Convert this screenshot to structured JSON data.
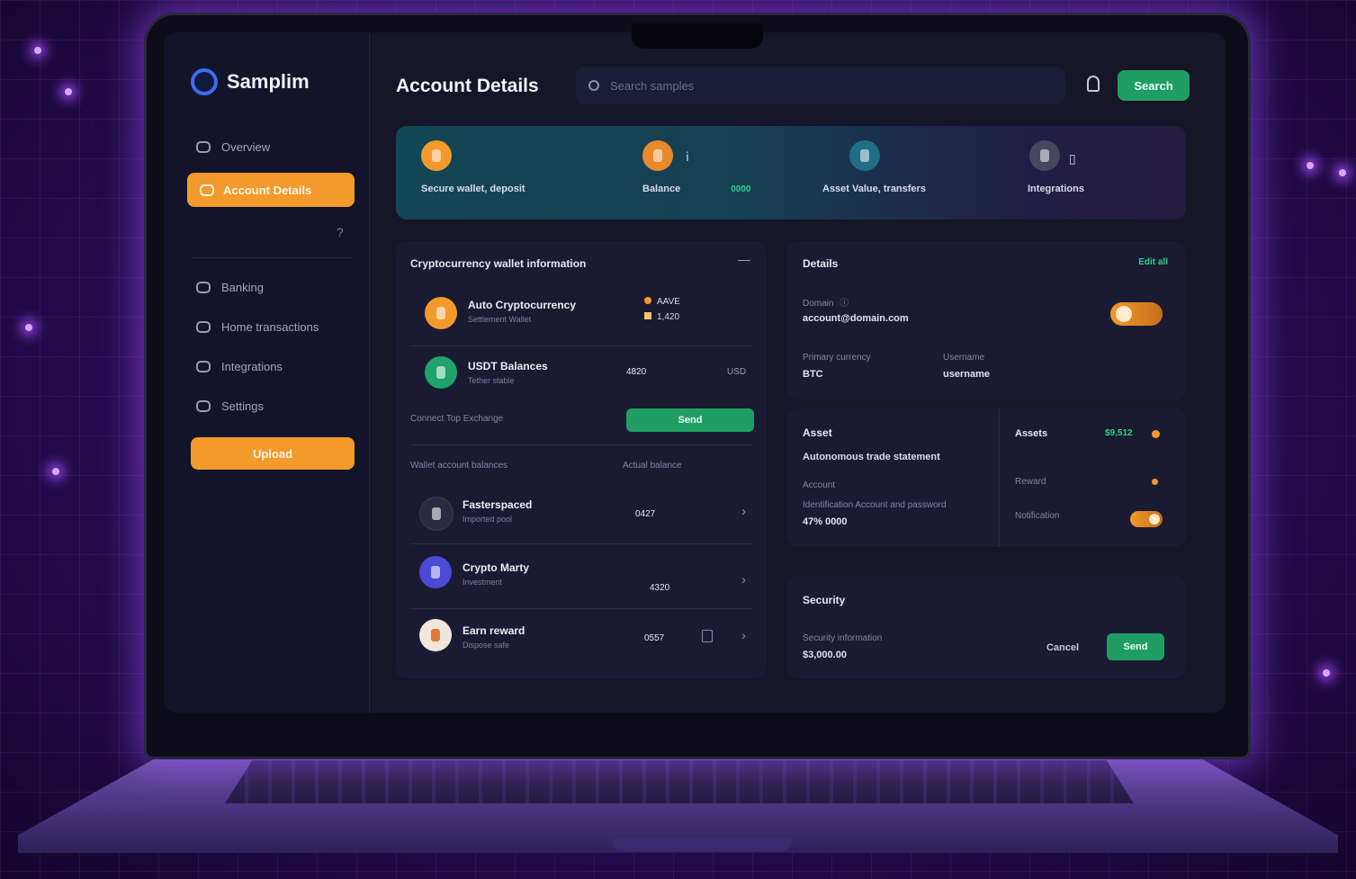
{
  "window": {
    "title": "Account Details"
  },
  "brand": {
    "name": "Samplim"
  },
  "topbar": {
    "title": "Account Details",
    "search_placeholder": "Search samples",
    "cta_label": "Search"
  },
  "sidebar": {
    "items": [
      {
        "label": "Overview",
        "icon": "chat-icon",
        "active": false
      },
      {
        "label": "Account Details",
        "icon": "wallet-icon",
        "active": true
      },
      {
        "label": "Banking",
        "icon": "bank-icon",
        "active": false
      },
      {
        "label": "Home transactions",
        "icon": "home-icon",
        "active": false
      },
      {
        "label": "Integrations",
        "icon": "plug-icon",
        "active": false
      },
      {
        "label": "Settings",
        "icon": "gear-icon",
        "active": false
      }
    ],
    "mark": "?",
    "button_label": "Upload"
  },
  "stats": [
    {
      "label": "Secure wallet, deposit",
      "color": "#f39a2c",
      "sub": ""
    },
    {
      "label": "Balance",
      "color": "#e88a2a",
      "sub": "0000"
    },
    {
      "label": "Asset Value, transfers",
      "color": "#1e6f86",
      "sub": ""
    },
    {
      "label": "Integrations",
      "color": "#46465e",
      "sub": ""
    }
  ],
  "account_card": {
    "title": "Cryptocurrency wallet information",
    "collapse_icon": "—",
    "holdings": [
      {
        "name": "Auto Cryptocurrency",
        "sub": "Settlement Wallet",
        "color": "#f39a2c",
        "tag1": "AAVE",
        "tag2": "1,420"
      },
      {
        "name": "USDT Balances",
        "sub": "Tether stable",
        "color": "#1fa36b",
        "value": "4820",
        "unit": "USD"
      }
    ],
    "connect_text": "Connect Top Exchange",
    "connect_button": "Send",
    "list_header_left": "Wallet account balances",
    "list_header_right": "Actual balance",
    "transactions": [
      {
        "name": "Fasterspaced",
        "sub": "Imported pool",
        "value": "0427",
        "color": "#2a2a40"
      },
      {
        "name": "Crypto Marty",
        "sub": "Investment",
        "value": "4320",
        "color": "#4a49d8"
      },
      {
        "name": "Earn reward",
        "sub": "Dispose safe",
        "value": "0557",
        "color": "#f0e6dc"
      }
    ]
  },
  "details_card": {
    "title": "Details",
    "link": "Edit all",
    "field1_label": "Domain",
    "field1_value": "account@domain.com",
    "field2_label": "Primary currency",
    "field2_value": "BTC",
    "field3_label": "Username",
    "field3_value": "username"
  },
  "settings_card": {
    "title": "Asset",
    "subtitle": "Autonomous trade statement",
    "label1": "Account",
    "label2": "Identification Account and password",
    "value2": "47% 0000",
    "right_title": "Assets",
    "right_value": "$9,512",
    "right_row2": "Reward",
    "right_row3": "Notification"
  },
  "security_card": {
    "title": "Security",
    "label": "Security information",
    "value": "$3,000.00",
    "secondary_button": "Cancel",
    "primary_button": "Send"
  },
  "colors": {
    "accent_orange": "#f39a2c",
    "accent_green": "#1f9e63",
    "panel": "#1a1b33",
    "background_purple": "#2a0d5a"
  }
}
